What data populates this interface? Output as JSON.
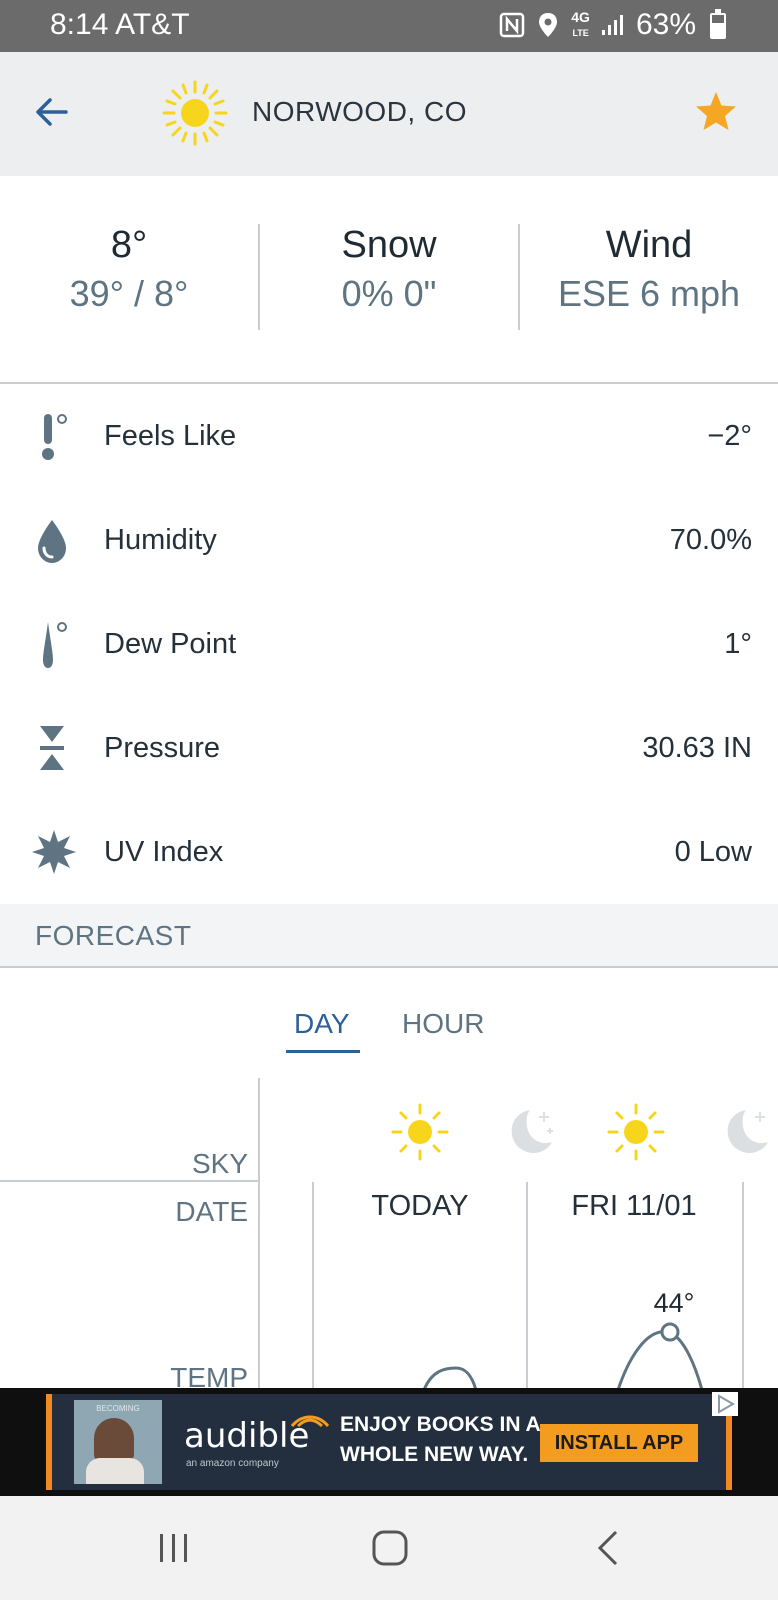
{
  "status_bar": {
    "time": "8:14",
    "carrier": "AT&T",
    "network": "4G",
    "network_sub": "LTE",
    "battery": "63%",
    "battery_level": 0.63,
    "icons": [
      "nfc-icon",
      "location-icon",
      "lte-icon",
      "signal-icon",
      "battery-icon"
    ]
  },
  "header": {
    "title": "NORWOOD, CO",
    "back_icon": "arrow-left-icon",
    "weather_icon": "sun-icon",
    "favorite_icon": "star-icon",
    "accent": "#2d5f9a",
    "star_color": "#f5a623"
  },
  "summary": {
    "temp": {
      "top": "8°",
      "bottom": "39° / 8°"
    },
    "snow": {
      "top": "Snow",
      "bottom": "0% 0\""
    },
    "wind": {
      "top": "Wind",
      "bottom": "ESE 6 mph"
    }
  },
  "details": [
    {
      "icon": "thermometer-icon",
      "label": "Feels Like",
      "value": "−2°"
    },
    {
      "icon": "water-drop-icon",
      "label": "Humidity",
      "value": "70.0%"
    },
    {
      "icon": "dew-point-icon",
      "label": "Dew Point",
      "value": "1°"
    },
    {
      "icon": "pressure-icon",
      "label": "Pressure",
      "value": "30.63 IN"
    },
    {
      "icon": "uv-icon",
      "label": "UV Index",
      "value": "0 Low"
    }
  ],
  "forecast": {
    "title": "FORECAST",
    "tabs": [
      {
        "label": "DAY",
        "active": true
      },
      {
        "label": "HOUR",
        "active": false
      }
    ],
    "row_labels": {
      "sky": "SKY",
      "date": "DATE",
      "temp": "TEMP"
    },
    "columns": [
      {
        "date": "TODAY",
        "day_icon": "sun-icon",
        "night_icon": "moon-icon"
      },
      {
        "date": "FRI 11/01",
        "day_icon": "sun-icon",
        "night_icon": "moon-icon",
        "high": "44°"
      }
    ]
  },
  "ad": {
    "brand": "audible",
    "brand_sub": "an amazon company",
    "text": "ENJOY BOOKS IN A WHOLE NEW WAY.",
    "cta": "INSTALL APP",
    "book_title": "BECOMING",
    "choices_icon": "adchoices-icon"
  },
  "navbar": {
    "icons": [
      "recent-apps-icon",
      "home-icon",
      "back-icon"
    ]
  }
}
